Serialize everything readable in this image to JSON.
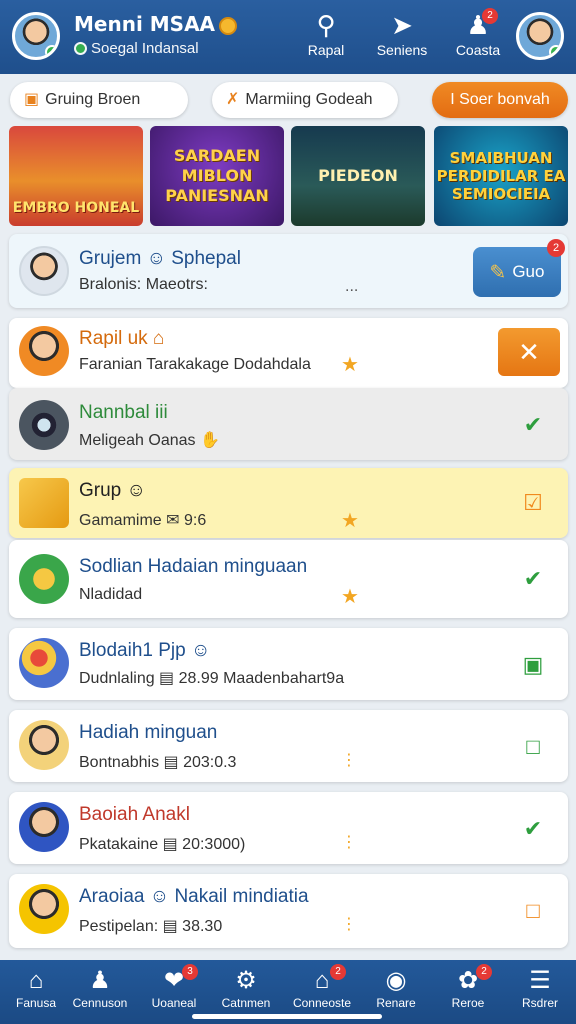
{
  "header": {
    "name": "Menni MSAA",
    "subtitle": "Soegal Indansal",
    "nav": [
      {
        "label": "Rapal",
        "icon": "search-icon"
      },
      {
        "label": "Seniens",
        "icon": "rocket-icon"
      },
      {
        "label": "Coasta",
        "icon": "users-icon",
        "badge": "2"
      }
    ]
  },
  "filters": [
    {
      "label": "Gruing Broen",
      "icon": "calendar-icon"
    },
    {
      "label": "Marmiing Godeah",
      "icon": "person-icon"
    },
    {
      "label": "I Soer bonvah"
    }
  ],
  "banners": [
    {
      "label": "EMBRO HONEAL"
    },
    {
      "label": "SARDAEN MIBLON PANIESNAN"
    },
    {
      "label": "PIEDEON"
    },
    {
      "label": "SMAIBHUAN PERDIDILAR EA SEMIOCIEIA"
    }
  ],
  "group_card": {
    "title": "Grujem ☺ Sphepal",
    "subtitle": "Bralonis: Maeotrs:",
    "dots": "...",
    "button_label": "Guo",
    "button_badge": "2"
  },
  "items": [
    {
      "title": "Rapil uk ⌂",
      "subtitle": "Faranian Tarakakage Dodahdala",
      "status": "close"
    },
    {
      "title": "Nannbal iii",
      "subtitle": "Meligeah Oanas ✋",
      "status": "check"
    },
    {
      "title": "Grup ☺",
      "subtitle": "Gamamime ✉ 9:6",
      "status": "check"
    },
    {
      "title": "Sodlian Hadaian minguaan",
      "subtitle": "Nladidad",
      "status": "check"
    },
    {
      "title": "Blodaih1 Pjp ☺",
      "subtitle": "Dudnlaling ▤ 28.99 Maadenbahart9a",
      "status": "bag"
    },
    {
      "title": "Hadiah minguan",
      "subtitle": "Bontnabhis ▤ 203:0.3",
      "status": "bag"
    },
    {
      "title": "Baoiah Anakl",
      "subtitle": "Pkatakaine ▤ 20:3000)",
      "status": "check"
    },
    {
      "title": "Araoiaa ☺ Nakail mindiatia",
      "subtitle": "Pestipelan: ▤ 38.30",
      "status": "bag"
    }
  ],
  "bottom_nav": [
    {
      "label": "Fanusa",
      "icon": "home-icon"
    },
    {
      "label": "Cennuson",
      "icon": "person-icon"
    },
    {
      "label": "Uoaneal",
      "icon": "chat-icon",
      "badge": "3"
    },
    {
      "label": "Catnmen",
      "icon": "gear-icon"
    },
    {
      "label": "Conneoste",
      "icon": "house-icon",
      "badge": "2"
    },
    {
      "label": "Renare",
      "icon": "clock-icon"
    },
    {
      "label": "Reroe",
      "icon": "gift-icon",
      "badge": "2"
    },
    {
      "label": "Rsdrer",
      "icon": "menu-icon"
    }
  ],
  "colors": {
    "header": "#2a5fa0",
    "accent_orange": "#f08a24",
    "status_green": "#2e9e3e",
    "highlight": "#fdf3b4"
  }
}
